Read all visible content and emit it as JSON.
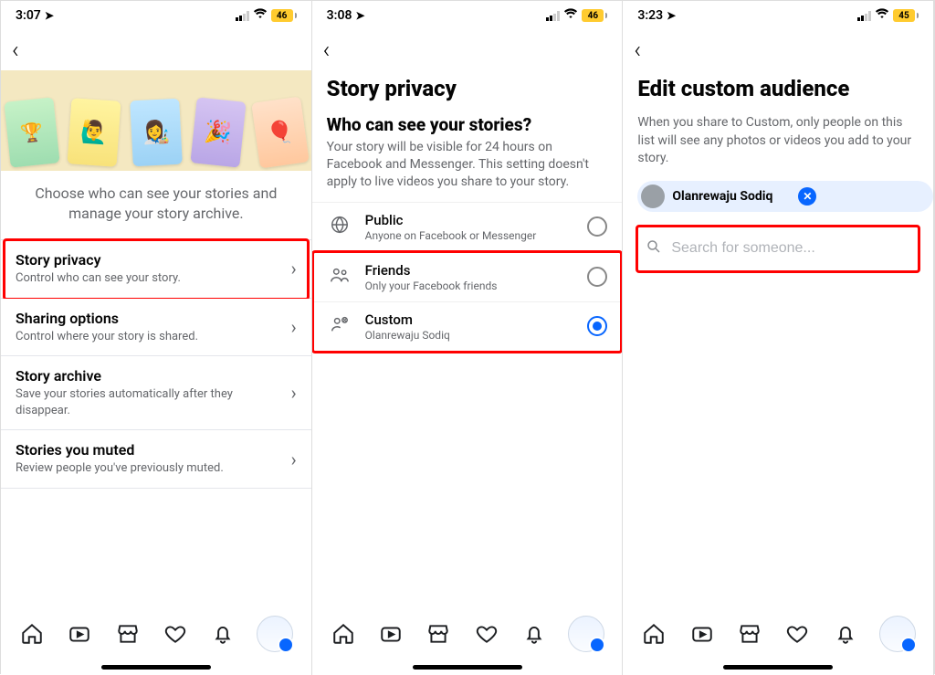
{
  "screens": [
    {
      "status": {
        "time": "3:07",
        "battery": "46"
      },
      "hero_caption": "Choose who can see your stories and manage your story archive.",
      "rows": [
        {
          "title": "Story privacy",
          "sub": "Control who can see your story.",
          "highlight": true
        },
        {
          "title": "Sharing options",
          "sub": "Control where your story is shared."
        },
        {
          "title": "Story archive",
          "sub": "Save your stories automatically after they disappear."
        },
        {
          "title": "Stories you muted",
          "sub": "Review people you've previously muted."
        }
      ]
    },
    {
      "status": {
        "time": "3:08",
        "battery": "46"
      },
      "title": "Story privacy",
      "section_title": "Who can see your stories?",
      "section_desc": "Your story will be visible for 24 hours on Facebook and Messenger. This setting doesn't apply to live videos you share to your story.",
      "options": [
        {
          "icon": "globe",
          "title": "Public",
          "sub": "Anyone on Facebook or Messenger",
          "checked": false
        },
        {
          "icon": "friends",
          "title": "Friends",
          "sub": "Only your Facebook friends",
          "checked": false
        },
        {
          "icon": "custom",
          "title": "Custom",
          "sub": "Olanrewaju Sodiq",
          "checked": true
        }
      ],
      "highlight_friends_custom": true
    },
    {
      "status": {
        "time": "3:23",
        "battery": "45"
      },
      "title": "Edit custom audience",
      "desc": "When you share to Custom, only people on this list will see any photos or videos you add to your story.",
      "chip": {
        "name": "Olanrewaju Sodiq"
      },
      "search_placeholder": "Search for someone..."
    }
  ],
  "tabbar": [
    "home",
    "video",
    "market",
    "heart",
    "bell",
    "profile"
  ]
}
